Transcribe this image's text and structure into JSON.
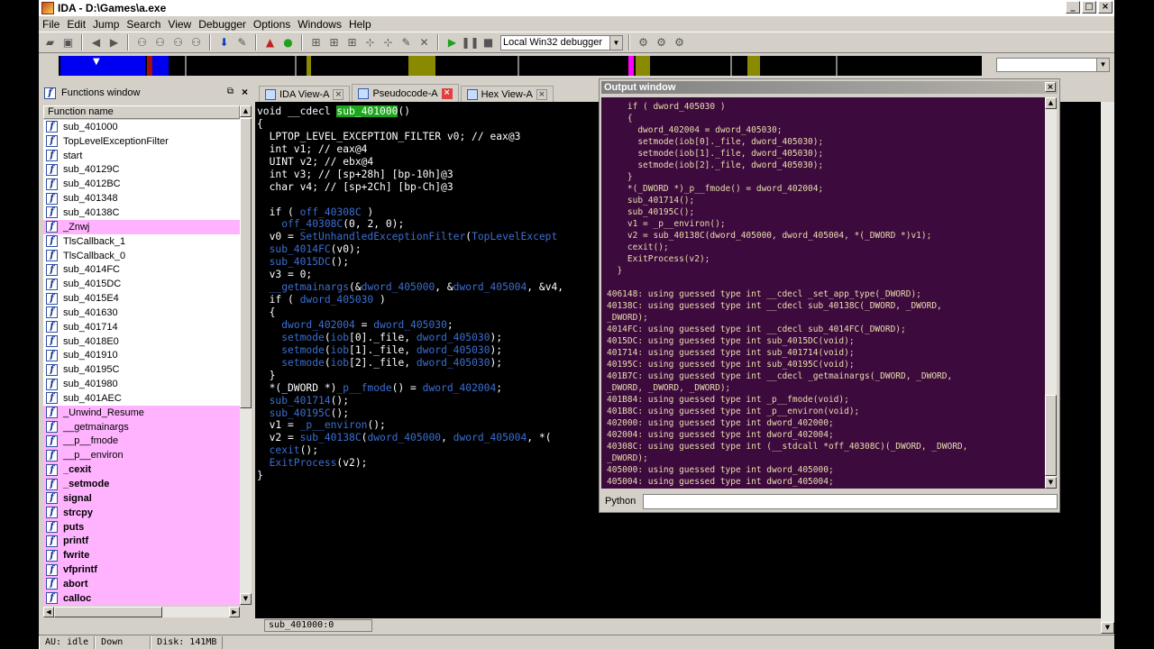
{
  "window": {
    "title": "IDA - D:\\Games\\a.exe",
    "controls": {
      "minimize": "_",
      "maximize": "□",
      "close": "×"
    }
  },
  "menu": [
    "File",
    "Edit",
    "Jump",
    "Search",
    "View",
    "Debugger",
    "Options",
    "Windows",
    "Help"
  ],
  "toolbar": {
    "debugger_select": "Local Win32 debugger"
  },
  "functions_window": {
    "title": "Functions window",
    "column_header": "Function name",
    "items": [
      {
        "name": "sub_401000",
        "lib": false,
        "bold": false
      },
      {
        "name": "TopLevelExceptionFilter",
        "lib": false,
        "bold": false
      },
      {
        "name": "start",
        "lib": false,
        "bold": false
      },
      {
        "name": "sub_40129C",
        "lib": false,
        "bold": false
      },
      {
        "name": "sub_4012BC",
        "lib": false,
        "bold": false
      },
      {
        "name": "sub_401348",
        "lib": false,
        "bold": false
      },
      {
        "name": "sub_40138C",
        "lib": false,
        "bold": false
      },
      {
        "name": "_Znwj",
        "lib": true,
        "bold": false
      },
      {
        "name": "TlsCallback_1",
        "lib": false,
        "bold": false
      },
      {
        "name": "TlsCallback_0",
        "lib": false,
        "bold": false
      },
      {
        "name": "sub_4014FC",
        "lib": false,
        "bold": false
      },
      {
        "name": "sub_4015DC",
        "lib": false,
        "bold": false
      },
      {
        "name": "sub_4015E4",
        "lib": false,
        "bold": false
      },
      {
        "name": "sub_401630",
        "lib": false,
        "bold": false
      },
      {
        "name": "sub_401714",
        "lib": false,
        "bold": false
      },
      {
        "name": "sub_4018E0",
        "lib": false,
        "bold": false
      },
      {
        "name": "sub_401910",
        "lib": false,
        "bold": false
      },
      {
        "name": "sub_40195C",
        "lib": false,
        "bold": false
      },
      {
        "name": "sub_401980",
        "lib": false,
        "bold": false
      },
      {
        "name": "sub_401AEC",
        "lib": false,
        "bold": false
      },
      {
        "name": "_Unwind_Resume",
        "lib": true,
        "bold": false
      },
      {
        "name": "__getmainargs",
        "lib": true,
        "bold": false
      },
      {
        "name": "__p__fmode",
        "lib": true,
        "bold": false
      },
      {
        "name": "__p__environ",
        "lib": true,
        "bold": false
      },
      {
        "name": "_cexit",
        "lib": true,
        "bold": true
      },
      {
        "name": "_setmode",
        "lib": true,
        "bold": true
      },
      {
        "name": "signal",
        "lib": true,
        "bold": true
      },
      {
        "name": "strcpy",
        "lib": true,
        "bold": true
      },
      {
        "name": "puts",
        "lib": true,
        "bold": true
      },
      {
        "name": "printf",
        "lib": true,
        "bold": true
      },
      {
        "name": "fwrite",
        "lib": true,
        "bold": true
      },
      {
        "name": "vfprintf",
        "lib": true,
        "bold": true
      },
      {
        "name": "abort",
        "lib": true,
        "bold": true
      },
      {
        "name": "calloc",
        "lib": true,
        "bold": true
      }
    ]
  },
  "tabs": [
    {
      "label": "IDA View-A",
      "active": false
    },
    {
      "label": "Pseudocode-A",
      "active": true
    },
    {
      "label": "Hex View-A",
      "active": false
    }
  ],
  "pseudocode": [
    [
      [
        "kw",
        "void __cdecl "
      ],
      [
        "hl",
        "sub_401000"
      ],
      [
        "kw",
        "()"
      ]
    ],
    [
      [
        "kw",
        "{"
      ]
    ],
    [
      [
        "kw",
        "  LPTOP_LEVEL_EXCEPTION_FILTER v0; // eax@3"
      ]
    ],
    [
      [
        "kw",
        "  int v1; // eax@4"
      ]
    ],
    [
      [
        "kw",
        "  UINT v2; // ebx@4"
      ]
    ],
    [
      [
        "kw",
        "  int v3; // [sp+28h] [bp-10h]@3"
      ]
    ],
    [
      [
        "kw",
        "  char v4; // [sp+2Ch] [bp-Ch]@3"
      ]
    ],
    [
      [
        "kw",
        ""
      ]
    ],
    [
      [
        "kw",
        "  if ( "
      ],
      [
        "gv",
        "off_40308C"
      ],
      [
        "kw",
        " )"
      ]
    ],
    [
      [
        "kw",
        "    "
      ],
      [
        "gv",
        "off_40308C"
      ],
      [
        "kw",
        "(0, 2, 0);"
      ]
    ],
    [
      [
        "kw",
        "  v0 = "
      ],
      [
        "fnc",
        "SetUnhandledExceptionFilter"
      ],
      [
        "kw",
        "("
      ],
      [
        "fnc",
        "TopLevelExcept"
      ]
    ],
    [
      [
        "fnc",
        "  sub_4014FC"
      ],
      [
        "kw",
        "(v0);"
      ]
    ],
    [
      [
        "fnc",
        "  sub_4015DC"
      ],
      [
        "kw",
        "();"
      ]
    ],
    [
      [
        "kw",
        "  v3 = 0;"
      ]
    ],
    [
      [
        "fnc",
        "  __getmainargs"
      ],
      [
        "kw",
        "(&"
      ],
      [
        "gv",
        "dword_405000"
      ],
      [
        "kw",
        ", &"
      ],
      [
        "gv",
        "dword_405004"
      ],
      [
        "kw",
        ", &v4,"
      ]
    ],
    [
      [
        "kw",
        "  if ( "
      ],
      [
        "gv",
        "dword_405030"
      ],
      [
        "kw",
        " )"
      ]
    ],
    [
      [
        "kw",
        "  {"
      ]
    ],
    [
      [
        "kw",
        "    "
      ],
      [
        "gv",
        "dword_402004"
      ],
      [
        "kw",
        " = "
      ],
      [
        "gv",
        "dword_405030"
      ],
      [
        "kw",
        ";"
      ]
    ],
    [
      [
        "kw",
        "    "
      ],
      [
        "fnc",
        "setmode"
      ],
      [
        "kw",
        "("
      ],
      [
        "gv",
        "iob"
      ],
      [
        "kw",
        "[0]._file, "
      ],
      [
        "gv",
        "dword_405030"
      ],
      [
        "kw",
        ");"
      ]
    ],
    [
      [
        "kw",
        "    "
      ],
      [
        "fnc",
        "setmode"
      ],
      [
        "kw",
        "("
      ],
      [
        "gv",
        "iob"
      ],
      [
        "kw",
        "[1]._file, "
      ],
      [
        "gv",
        "dword_405030"
      ],
      [
        "kw",
        ");"
      ]
    ],
    [
      [
        "kw",
        "    "
      ],
      [
        "fnc",
        "setmode"
      ],
      [
        "kw",
        "("
      ],
      [
        "gv",
        "iob"
      ],
      [
        "kw",
        "[2]._file, "
      ],
      [
        "gv",
        "dword_405030"
      ],
      [
        "kw",
        ");"
      ]
    ],
    [
      [
        "kw",
        "  }"
      ]
    ],
    [
      [
        "kw",
        "  *(_DWORD *)"
      ],
      [
        "fnc",
        "_p__fmode"
      ],
      [
        "kw",
        "() = "
      ],
      [
        "gv",
        "dword_402004"
      ],
      [
        "kw",
        ";"
      ]
    ],
    [
      [
        "fnc",
        "  sub_401714"
      ],
      [
        "kw",
        "();"
      ]
    ],
    [
      [
        "fnc",
        "  sub_40195C"
      ],
      [
        "kw",
        "();"
      ]
    ],
    [
      [
        "kw",
        "  v1 = "
      ],
      [
        "fnc",
        "_p__environ"
      ],
      [
        "kw",
        "();"
      ]
    ],
    [
      [
        "kw",
        "  v2 = "
      ],
      [
        "fnc",
        "sub_40138C"
      ],
      [
        "kw",
        "("
      ],
      [
        "gv",
        "dword_405000"
      ],
      [
        "kw",
        ", "
      ],
      [
        "gv",
        "dword_405004"
      ],
      [
        "kw",
        ", *("
      ]
    ],
    [
      [
        "fnc",
        "  cexit"
      ],
      [
        "kw",
        "();"
      ]
    ],
    [
      [
        "fnc",
        "  ExitProcess"
      ],
      [
        "kw",
        "(v2);"
      ]
    ],
    [
      [
        "kw",
        "}"
      ]
    ]
  ],
  "code_status": "sub_401000:0",
  "output_window": {
    "title": "Output window",
    "lines": [
      "    if ( dword_405030 )",
      "    {",
      "      dword_402004 = dword_405030;",
      "      setmode(iob[0]._file, dword_405030);",
      "      setmode(iob[1]._file, dword_405030);",
      "      setmode(iob[2]._file, dword_405030);",
      "    }",
      "    *(_DWORD *)_p__fmode() = dword_402004;",
      "    sub_401714();",
      "    sub_40195C();",
      "    v1 = _p__environ();",
      "    v2 = sub_40138C(dword_405000, dword_405004, *(_DWORD *)v1);",
      "    cexit();",
      "    ExitProcess(v2);",
      "  }",
      "",
      "406148: using guessed type int __cdecl _set_app_type(_DWORD);",
      "40138C: using guessed type int __cdecl sub_40138C(_DWORD, _DWORD,",
      "_DWORD);",
      "4014FC: using guessed type int __cdecl sub_4014FC(_DWORD);",
      "4015DC: using guessed type int sub_4015DC(void);",
      "401714: using guessed type int sub_401714(void);",
      "40195C: using guessed type int sub_40195C(void);",
      "401B7C: using guessed type int __cdecl _getmainargs(_DWORD, _DWORD,",
      "_DWORD, _DWORD, _DWORD);",
      "401B84: using guessed type int _p__fmode(void);",
      "401B8C: using guessed type int _p__environ(void);",
      "402000: using guessed type int dword_402000;",
      "402004: using guessed type int dword_402004;",
      "40308C: using guessed type int (__stdcall *off_40308C)(_DWORD, _DWORD,",
      "_DWORD);",
      "405000: using guessed type int dword_405000;",
      "405004: using guessed type int dword_405004;"
    ],
    "python_label": "Python"
  },
  "status": {
    "au": "AU:  idle",
    "dir": "Down",
    "disk": "Disk: 141MB"
  },
  "colors": {
    "lib_function": "#ffb3ff",
    "highlight": "#1ea51e",
    "code_symbol": "#3b6fd1",
    "output_bg": "#3d0a3d",
    "output_text": "#e8dfae"
  }
}
